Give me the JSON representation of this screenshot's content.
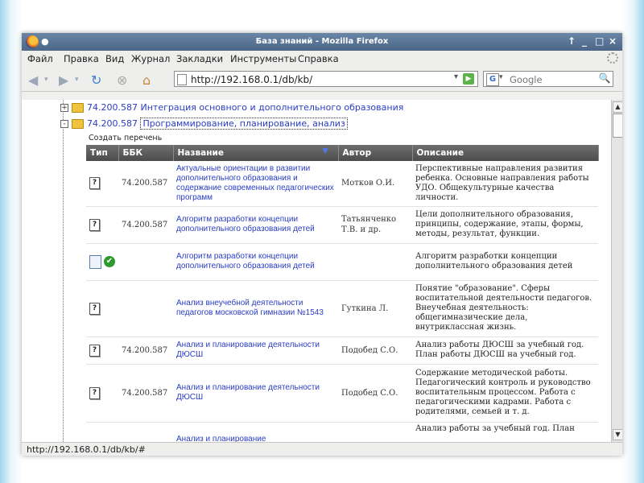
{
  "window": {
    "title": "База знаний - Mozilla Firefox",
    "controls": [
      "↑",
      "_",
      "□",
      "×"
    ]
  },
  "menu": {
    "items": [
      "Файл",
      "Правка",
      "Вид",
      "Журнал",
      "Закладки",
      "Инструменты",
      "Справка"
    ]
  },
  "navbar": {
    "url": "http://192.168.0.1/db/kb/",
    "search_placeholder": "Google"
  },
  "tree": {
    "node1": {
      "code": "74.200.587",
      "title": "Интеграция основного и дополнительного образования",
      "toggle": "+"
    },
    "node2": {
      "code": "74.200.587",
      "title": "Программирование, планирование, анализ",
      "toggle": "-"
    },
    "create_list": "Создать перечень"
  },
  "table": {
    "headers": {
      "type": "Тип",
      "bbk": "ББК",
      "name": "Название",
      "author": "Автор",
      "desc": "Описание"
    },
    "sort_indicator": "▼",
    "rows": [
      {
        "type": "?",
        "bbk": "74.200.587",
        "name": "Актуальные ориентации в развитии дополнительного образования и содержание современных педагогических программ",
        "author": "Мотков О.И.",
        "desc": "Перспективные направления развития ребенка. Основные направления работы УДО. Общекультурные качества личности."
      },
      {
        "type": "?",
        "bbk": "74.200.587",
        "name": "Алгоритм разработки концепции дополнительного образования детей",
        "author": "Татьянченко Т.В. и др.",
        "desc": "Цели дополнительного образования, принципы, содержание, этапы, формы, методы, результат, функции."
      },
      {
        "type": "doc-approved",
        "bbk": "",
        "name": "Алгоритм разработки концепции дополнительного образования детей",
        "author": "",
        "desc": "Алгоритм разработки концепции дополнительного образования детей"
      },
      {
        "type": "?",
        "bbk": "",
        "name": "Анализ внеучебной деятельности педагогов московской гимназии №1543",
        "author": "Гуткина Л.",
        "desc": "Понятие \"образование\". Сферы воспитательной деятельности педагогов. Внеучебная деятельность: общегимназические дела, внутриклассная жизнь."
      },
      {
        "type": "?",
        "bbk": "74.200.587",
        "name": "Анализ и планирование деятельности ДЮСШ",
        "author": "Подобед С.О.",
        "desc": "Анализ работы ДЮСШ за учебный год. План работы ДЮСШ на учебный год."
      },
      {
        "type": "?",
        "bbk": "74.200.587",
        "name": "Анализ и планирование деятельности ДЮСШ",
        "author": "Подобед С.О.",
        "desc": "Содержание методической работы. Педагогический контроль и руководство воспитательным процессом. Работа с педагогическими кадрами. Работа с родителями, семьей и т. д."
      },
      {
        "type": "",
        "bbk": "",
        "name": "Анализ и планирование",
        "author": "",
        "desc": "Анализ работы за учебный год. План"
      }
    ]
  },
  "statusbar": {
    "text": "http://192.168.0.1/db/kb/#"
  }
}
